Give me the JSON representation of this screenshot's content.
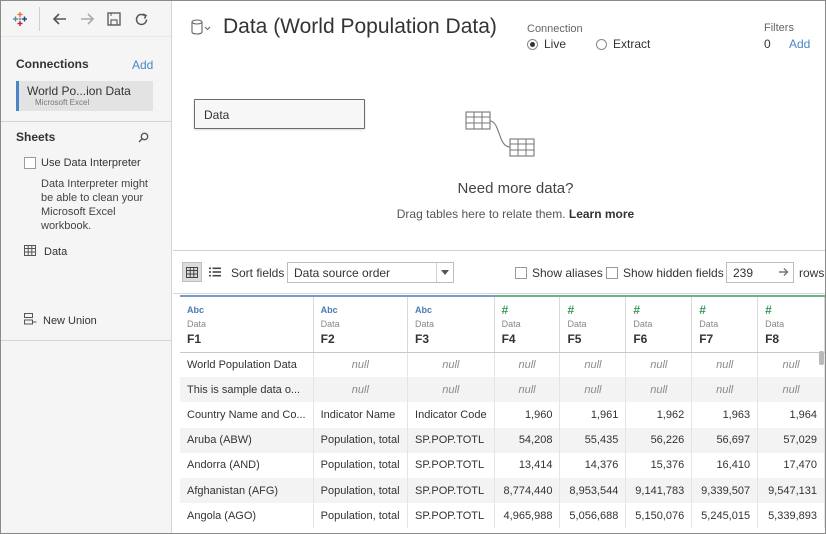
{
  "left": {
    "connections_title": "Connections",
    "add_label": "Add",
    "connection": {
      "name": "World Po...ion Data",
      "type": "Microsoft Excel"
    },
    "sheets_title": "Sheets",
    "interpreter_label": "Use Data Interpreter",
    "interpreter_desc": "Data Interpreter might be able to clean your Microsoft Excel workbook.",
    "sheet_name": "Data",
    "new_union_label": "New Union"
  },
  "header": {
    "title": "Data (World Population Data)",
    "connection_label": "Connection",
    "live_label": "Live",
    "extract_label": "Extract",
    "selected_connection": "Live",
    "filters_label": "Filters",
    "filters_count": "0",
    "filters_add": "Add"
  },
  "canvas": {
    "table_name": "Data",
    "need_more": "Need more data?",
    "drag_text": "Drag tables here to relate them.",
    "learn_more": "Learn more"
  },
  "grid_toolbar": {
    "sort_label": "Sort fields",
    "sort_value": "Data source order",
    "show_aliases": "Show aliases",
    "show_hidden": "Show hidden fields",
    "rows_value": "239",
    "rows_label": "rows"
  },
  "columns": [
    {
      "type": "str",
      "type_icon": "Abc",
      "source": "Data",
      "name": "F1"
    },
    {
      "type": "str",
      "type_icon": "Abc",
      "source": "Data",
      "name": "F2"
    },
    {
      "type": "str",
      "type_icon": "Abc",
      "source": "Data",
      "name": "F3"
    },
    {
      "type": "num",
      "type_icon": "#",
      "source": "Data",
      "name": "F4"
    },
    {
      "type": "num",
      "type_icon": "#",
      "source": "Data",
      "name": "F5"
    },
    {
      "type": "num",
      "type_icon": "#",
      "source": "Data",
      "name": "F6"
    },
    {
      "type": "num",
      "type_icon": "#",
      "source": "Data",
      "name": "F7"
    },
    {
      "type": "num",
      "type_icon": "#",
      "source": "Data",
      "name": "F8"
    }
  ],
  "rows": [
    [
      "World Population Data",
      "null",
      "null",
      "null",
      "null",
      "null",
      "null",
      "null"
    ],
    [
      "This is sample data o...",
      "null",
      "null",
      "null",
      "null",
      "null",
      "null",
      "null"
    ],
    [
      "Country Name and Co...",
      "Indicator Name",
      "Indicator Code",
      "1,960",
      "1,961",
      "1,962",
      "1,963",
      "1,964"
    ],
    [
      "Aruba (ABW)",
      "Population, total",
      "SP.POP.TOTL",
      "54,208",
      "55,435",
      "56,226",
      "56,697",
      "57,029"
    ],
    [
      "Andorra (AND)",
      "Population, total",
      "SP.POP.TOTL",
      "13,414",
      "14,376",
      "15,376",
      "16,410",
      "17,470"
    ],
    [
      "Afghanistan (AFG)",
      "Population, total",
      "SP.POP.TOTL",
      "8,774,440",
      "8,953,544",
      "9,141,783",
      "9,339,507",
      "9,547,131"
    ],
    [
      "Angola (AGO)",
      "Population, total",
      "SP.POP.TOTL",
      "4,965,988",
      "5,056,688",
      "5,150,076",
      "5,245,015",
      "5,339,893"
    ]
  ],
  "colors": {
    "accent": "#4a86c5",
    "numeric_type": "#3a9a5b",
    "string_type": "#4a7ab5"
  }
}
